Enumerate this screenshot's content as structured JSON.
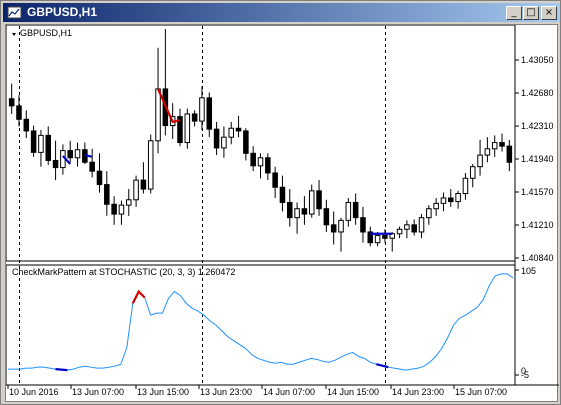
{
  "window": {
    "title": "GBPUSD,H1",
    "buttons": {
      "minimize": "_",
      "maximize": "□",
      "close": "×"
    }
  },
  "main_chart": {
    "label": "GBPUSD,H1",
    "price_ticks": [
      "1.43050",
      "1.42680",
      "1.42310",
      "1.41940",
      "1.41570",
      "1.41210",
      "1.40840"
    ]
  },
  "indicator": {
    "label": "CheckMarkPattern at STOCHASTIC (20, 3, 3) 1.260472",
    "y_ticks": [
      "105",
      "0",
      "-5"
    ]
  },
  "time_axis": {
    "labels": [
      "10 Jun 2016",
      "13 Jun 07:00",
      "13 Jun 15:00",
      "13 Jun 23:00",
      "14 Jun 07:00",
      "14 Jun 15:00",
      "14 Jun 23:00",
      "15 Jun 07:00"
    ]
  },
  "colors": {
    "bull_candle": "#ffffff",
    "bear_candle": "#000000",
    "pattern_up": "#d00000",
    "pattern_down": "#0000c0",
    "stochastic_line": "#1e90ff",
    "separator": "#000000"
  },
  "chart_data": [
    {
      "type": "candlestick",
      "title": "GBPUSD,H1",
      "ylim": [
        1.4084,
        1.4339
      ],
      "ohlc": [
        [
          1.4261,
          1.4278,
          1.4244,
          1.4253
        ],
        [
          1.4253,
          1.4265,
          1.423,
          1.4238
        ],
        [
          1.4238,
          1.4248,
          1.4217,
          1.4225
        ],
        [
          1.4225,
          1.4231,
          1.4196,
          1.4201
        ],
        [
          1.4201,
          1.4226,
          1.4185,
          1.422
        ],
        [
          1.422,
          1.423,
          1.4187,
          1.4192
        ],
        [
          1.4192,
          1.4214,
          1.417,
          1.4184
        ],
        [
          1.4184,
          1.421,
          1.4176,
          1.4203
        ],
        [
          1.4203,
          1.4214,
          1.419,
          1.4195
        ],
        [
          1.4195,
          1.4212,
          1.4185,
          1.4204
        ],
        [
          1.4204,
          1.4212,
          1.4188,
          1.419
        ],
        [
          1.419,
          1.4205,
          1.4173,
          1.418
        ],
        [
          1.418,
          1.42,
          1.4156,
          1.4165
        ],
        [
          1.4165,
          1.418,
          1.413,
          1.4143
        ],
        [
          1.4143,
          1.4152,
          1.412,
          1.4132
        ],
        [
          1.4132,
          1.4147,
          1.412,
          1.4142
        ],
        [
          1.4142,
          1.416,
          1.413,
          1.4148
        ],
        [
          1.4148,
          1.4175,
          1.414,
          1.417
        ],
        [
          1.417,
          1.419,
          1.4155,
          1.416
        ],
        [
          1.416,
          1.4221,
          1.4155,
          1.4214
        ],
        [
          1.4214,
          1.4318,
          1.42,
          1.4272
        ],
        [
          1.4272,
          1.4339,
          1.422,
          1.4231
        ],
        [
          1.4231,
          1.4256,
          1.4216,
          1.4241
        ],
        [
          1.4241,
          1.425,
          1.4208,
          1.4212
        ],
        [
          1.4212,
          1.425,
          1.4205,
          1.4244
        ],
        [
          1.4244,
          1.4248,
          1.423,
          1.4236
        ],
        [
          1.4236,
          1.4275,
          1.4226,
          1.4262
        ],
        [
          1.4262,
          1.4268,
          1.4218,
          1.4227
        ],
        [
          1.4227,
          1.4235,
          1.4198,
          1.4206
        ],
        [
          1.4206,
          1.423,
          1.4195,
          1.4218
        ],
        [
          1.4218,
          1.4235,
          1.421,
          1.4228
        ],
        [
          1.4228,
          1.4242,
          1.4218,
          1.4225
        ],
        [
          1.4225,
          1.4228,
          1.4192,
          1.42
        ],
        [
          1.42,
          1.4208,
          1.418,
          1.4186
        ],
        [
          1.4186,
          1.42,
          1.4172,
          1.4195
        ],
        [
          1.4195,
          1.42,
          1.417,
          1.4178
        ],
        [
          1.4178,
          1.4185,
          1.415,
          1.4162
        ],
        [
          1.4162,
          1.4175,
          1.4135,
          1.4145
        ],
        [
          1.4145,
          1.416,
          1.4118,
          1.4128
        ],
        [
          1.4128,
          1.4145,
          1.411,
          1.4138
        ],
        [
          1.4138,
          1.4152,
          1.412,
          1.4132
        ],
        [
          1.4132,
          1.4165,
          1.4128,
          1.4158
        ],
        [
          1.4158,
          1.417,
          1.413,
          1.4138
        ],
        [
          1.4138,
          1.4148,
          1.4112,
          1.412
        ],
        [
          1.412,
          1.4135,
          1.4098,
          1.4112
        ],
        [
          1.4112,
          1.4128,
          1.409,
          1.4125
        ],
        [
          1.4125,
          1.415,
          1.4118,
          1.4145
        ],
        [
          1.4145,
          1.4155,
          1.412,
          1.4128
        ],
        [
          1.4128,
          1.414,
          1.41,
          1.4112
        ],
        [
          1.4112,
          1.4118,
          1.4096,
          1.41
        ],
        [
          1.41,
          1.4112,
          1.4096,
          1.4108
        ],
        [
          1.4108,
          1.4115,
          1.41,
          1.4105
        ],
        [
          1.4105,
          1.4112,
          1.409,
          1.411
        ],
        [
          1.411,
          1.4118,
          1.4105,
          1.4115
        ],
        [
          1.4115,
          1.4125,
          1.4105,
          1.412
        ],
        [
          1.412,
          1.4126,
          1.4108,
          1.4112
        ],
        [
          1.4112,
          1.4132,
          1.4105,
          1.4128
        ],
        [
          1.4128,
          1.4142,
          1.412,
          1.4138
        ],
        [
          1.4138,
          1.415,
          1.413,
          1.4144
        ],
        [
          1.4144,
          1.4156,
          1.4135,
          1.415
        ],
        [
          1.415,
          1.416,
          1.414,
          1.4146
        ],
        [
          1.4146,
          1.4158,
          1.4138,
          1.4155
        ],
        [
          1.4155,
          1.4178,
          1.4148,
          1.4172
        ],
        [
          1.4172,
          1.4188,
          1.4162,
          1.4185
        ],
        [
          1.4185,
          1.4215,
          1.4175,
          1.4198
        ],
        [
          1.4198,
          1.4218,
          1.419,
          1.4205
        ],
        [
          1.4205,
          1.422,
          1.4196,
          1.4212
        ],
        [
          1.4212,
          1.4222,
          1.4202,
          1.4208
        ],
        [
          1.4208,
          1.4215,
          1.418,
          1.419
        ]
      ],
      "pattern_up": [
        [
          20,
          1.4272
        ],
        [
          22,
          1.4235
        ],
        [
          23,
          1.4237
        ]
      ],
      "pattern_down": [
        [
          7,
          1.4197
        ],
        [
          8,
          1.4188
        ],
        [
          10,
          1.4198
        ],
        [
          11,
          1.4196
        ],
        [
          49,
          1.411
        ],
        [
          52,
          1.411
        ]
      ],
      "vlines": [
        1,
        26,
        51
      ]
    },
    {
      "type": "line",
      "title": "CheckMarkPattern at STOCHASTIC (20, 3, 3) 1.260472",
      "ylim": [
        -5,
        105
      ],
      "series": [
        {
          "values": [
            3,
            3,
            3,
            4,
            4,
            5,
            5,
            4,
            3,
            2,
            2,
            3,
            5,
            6,
            5,
            4,
            4,
            5,
            6,
            8,
            25,
            70,
            82,
            76,
            58,
            60,
            60,
            75,
            82,
            78,
            70,
            65,
            62,
            58,
            52,
            48,
            42,
            36,
            32,
            28,
            24,
            18,
            14,
            12,
            10,
            9,
            10,
            8,
            8,
            10,
            12,
            14,
            13,
            11,
            10,
            12,
            15,
            18,
            20,
            16,
            14,
            10,
            8,
            6,
            5,
            4,
            3,
            2,
            3,
            4,
            6,
            10,
            16,
            24,
            35,
            48,
            55,
            58,
            62,
            66,
            74,
            88,
            98,
            100,
            100,
            96
          ]
        }
      ],
      "pattern_up": [
        [
          21,
          70
        ],
        [
          22,
          82
        ],
        [
          23,
          76
        ]
      ],
      "pattern_down": [
        [
          8,
          3
        ],
        [
          10,
          2
        ],
        [
          62,
          8
        ],
        [
          64,
          5
        ]
      ]
    }
  ]
}
